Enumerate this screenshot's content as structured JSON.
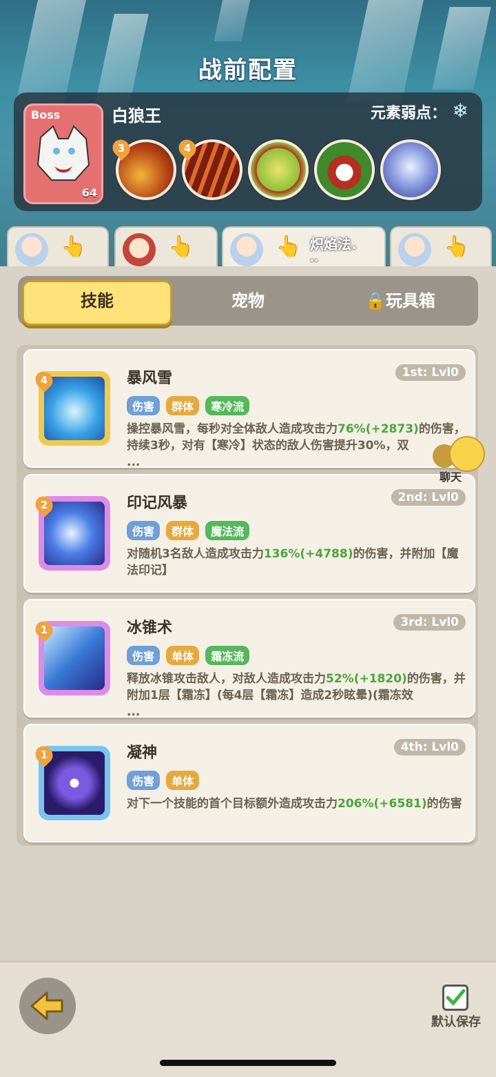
{
  "header": {
    "title": "战前配置"
  },
  "boss": {
    "tag": "Boss",
    "level": "64",
    "name": "白狼王",
    "weakness_label": "元素弱点：",
    "weakness_icon": "snowflake-icon",
    "skills": [
      {
        "icon": "fire-claw-icon",
        "badge": "3"
      },
      {
        "icon": "slash-claw-icon",
        "badge": "4"
      },
      {
        "icon": "punch-icon",
        "badge": ""
      },
      {
        "icon": "bite-icon",
        "badge": ""
      },
      {
        "icon": "ice-crystal-icon",
        "badge": ""
      }
    ]
  },
  "heroes": [
    {
      "name": ""
    },
    {
      "name": ""
    },
    {
      "name": "炽焰法.",
      "sub": ".."
    },
    {
      "name": ""
    }
  ],
  "tabs": {
    "skills": "技能",
    "pets": "宠物",
    "toybox": "玩具箱"
  },
  "skills": [
    {
      "level": "4",
      "name": "暴风雪",
      "rank": "1st: Lvl0",
      "tags": [
        "伤害",
        "群体",
        "寒冷流"
      ],
      "desc1": "操控暴风雪，每秒对全体敌人造成攻击力",
      "pct": "76%",
      "bonus": "(+2873)",
      "desc2": "的伤害，持续3秒，对有【寒冷】状态的敌人伤害提升30%，双",
      "more": "..."
    },
    {
      "level": "2",
      "name": "印记风暴",
      "rank": "2nd: Lvl0",
      "tags": [
        "伤害",
        "群体",
        "魔法流"
      ],
      "desc1": "对随机3名敌人造成攻击力",
      "pct": "136%",
      "bonus": "(+4788)",
      "desc2": "的伤害，并附加【魔法印记】",
      "more": ""
    },
    {
      "level": "1",
      "name": "冰锥术",
      "rank": "3rd: Lvl0",
      "tags": [
        "伤害",
        "单体",
        "霜冻流"
      ],
      "desc1": "释放冰锥攻击敌人，对敌人造成攻击力",
      "pct": "52%",
      "bonus": "(+1820)",
      "desc2": "的伤害，并附加1层【霜冻】(每4层【霜冻】造成2秒眩晕)(霜冻效",
      "more": "..."
    },
    {
      "level": "1",
      "name": "凝神",
      "rank": "4th: Lvl0",
      "tags": [
        "伤害",
        "单体"
      ],
      "desc1": "对下一个技能的首个目标额外造成攻击力",
      "pct": "206%",
      "bonus": "(+6581)",
      "desc2": "的伤害",
      "more": ""
    }
  ],
  "chat": {
    "label": "聊天"
  },
  "footer": {
    "save_label": "默认保存"
  },
  "colors": {
    "damage": "#6f9fd6",
    "group": "#e6a93f",
    "single": "#e6a93f",
    "school": "#55b85a"
  }
}
